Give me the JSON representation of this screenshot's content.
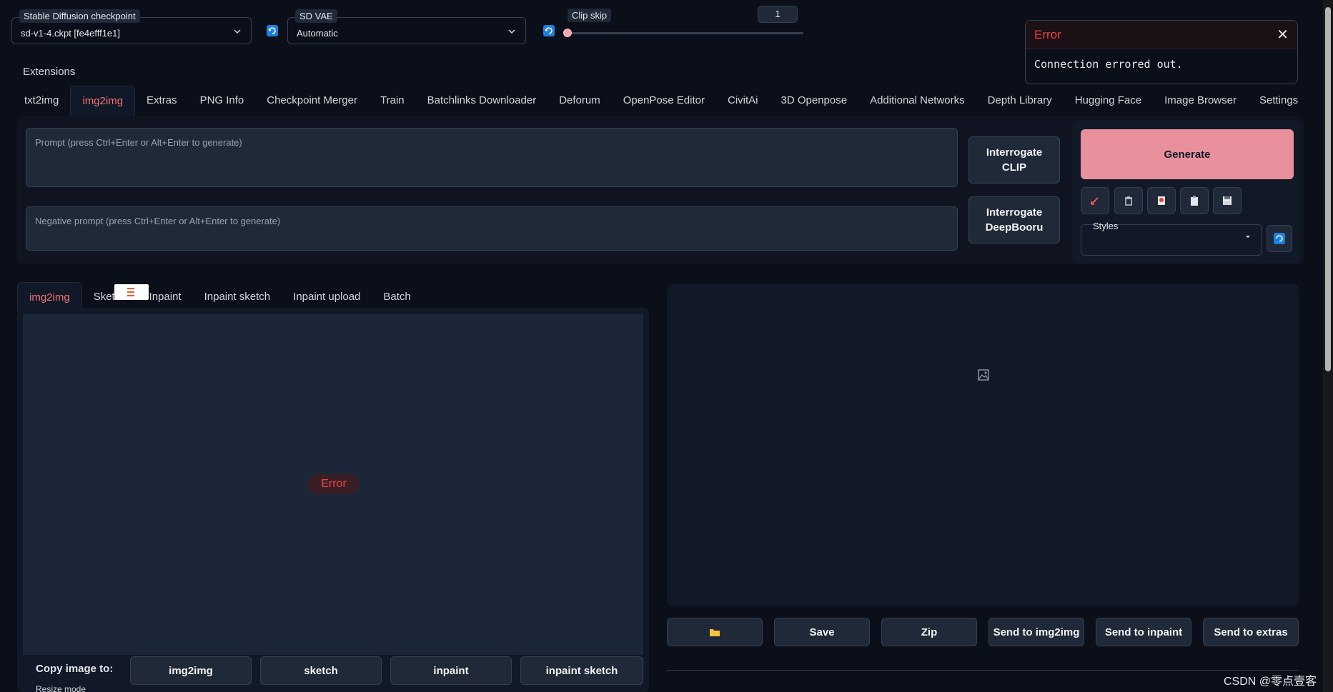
{
  "settings": {
    "checkpoint": {
      "label": "Stable Diffusion checkpoint",
      "value": "sd-v1-4.ckpt [fe4efff1e1]"
    },
    "vae": {
      "label": "SD VAE",
      "value": "Automatic"
    },
    "clip_skip": {
      "label": "Clip skip",
      "value": "1"
    }
  },
  "toast": {
    "title": "Error",
    "close": "✕",
    "message": "Connection errored out."
  },
  "extensions_label": "Extensions",
  "main_tabs": [
    "txt2img",
    "img2img",
    "Extras",
    "PNG Info",
    "Checkpoint Merger",
    "Train",
    "Batchlinks Downloader",
    "Deforum",
    "OpenPose Editor",
    "CivitAi",
    "3D Openpose",
    "Additional Networks",
    "Depth Library",
    "Hugging Face",
    "Image Browser",
    "Settings"
  ],
  "prompt": {
    "placeholder": "Prompt (press Ctrl+Enter or Alt+Enter to generate)"
  },
  "negative_prompt": {
    "placeholder": "Negative prompt (press Ctrl+Enter or Alt+Enter to generate)"
  },
  "buttons": {
    "interrogate_clip": "Interrogate CLIP",
    "interrogate_deepbooru": "Interrogate DeepBooru",
    "generate": "Generate"
  },
  "styles_label": "Styles",
  "sub_tabs": [
    "img2img",
    "Sketch",
    "Inpaint",
    "Inpaint sketch",
    "Inpaint upload",
    "Batch"
  ],
  "image_error": "Error",
  "copy_image_to": {
    "label": "Copy image to:",
    "buttons": [
      "img2img",
      "sketch",
      "inpaint",
      "inpaint sketch"
    ]
  },
  "resize_mode_label": "Resize mode",
  "output_buttons": [
    "Save",
    "Zip",
    "Send to img2img",
    "Send to inpaint",
    "Send to extras"
  ],
  "watermark": "CSDN @零点壹客",
  "colors": {
    "accent": "#e8919c",
    "error": "#ef4444",
    "background": "#0b0f19"
  }
}
